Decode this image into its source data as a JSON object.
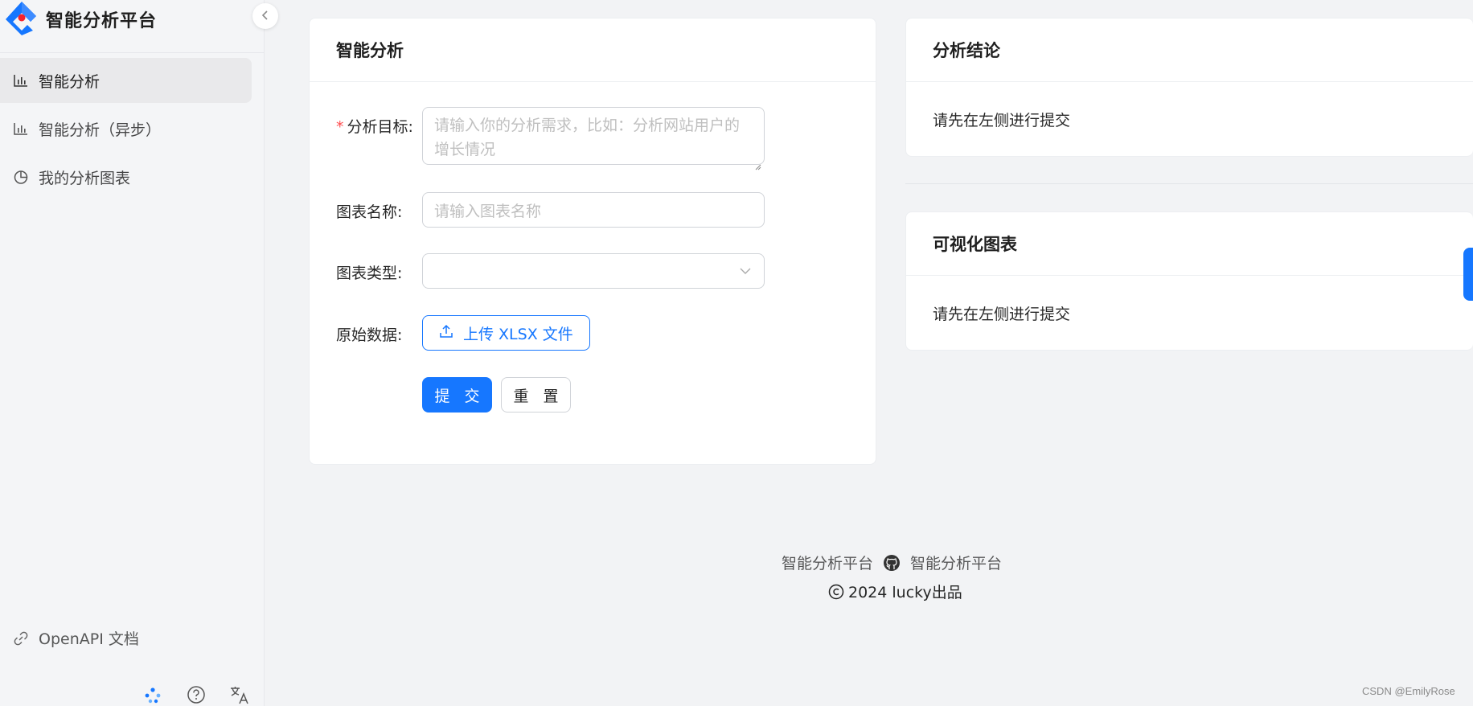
{
  "app": {
    "title": "智能分析平台"
  },
  "sidebar": {
    "items": [
      {
        "label": "智能分析",
        "icon": "bar-chart-icon",
        "active": true
      },
      {
        "label": "智能分析（异步）",
        "icon": "bar-chart-icon",
        "active": false
      },
      {
        "label": "我的分析图表",
        "icon": "pie-chart-icon",
        "active": false
      }
    ],
    "openapi_label": "OpenAPI 文档",
    "bottom_icons": [
      "cluster-icon",
      "question-icon",
      "translate-icon"
    ]
  },
  "form_card": {
    "title": "智能分析",
    "goal_label": "分析目标:",
    "goal_placeholder": "请输入你的分析需求，比如：分析网站用户的增长情况",
    "name_label": "图表名称:",
    "name_placeholder": "请输入图表名称",
    "type_label": "图表类型:",
    "type_value": "",
    "data_label": "原始数据:",
    "upload_label": "上传 XLSX 文件",
    "submit_label": "提 交",
    "reset_label": "重 置"
  },
  "result_card": {
    "title": "分析结论",
    "text": "请先在左侧进行提交"
  },
  "chart_card": {
    "title": "可视化图表",
    "text": "请先在左侧进行提交"
  },
  "footer": {
    "link1": "智能分析平台",
    "link2": "智能分析平台",
    "copyright": "2024 lucky出品"
  },
  "watermark": "CSDN @EmilyRose",
  "colors": {
    "primary": "#1677ff",
    "required": "#ff4d4f"
  }
}
